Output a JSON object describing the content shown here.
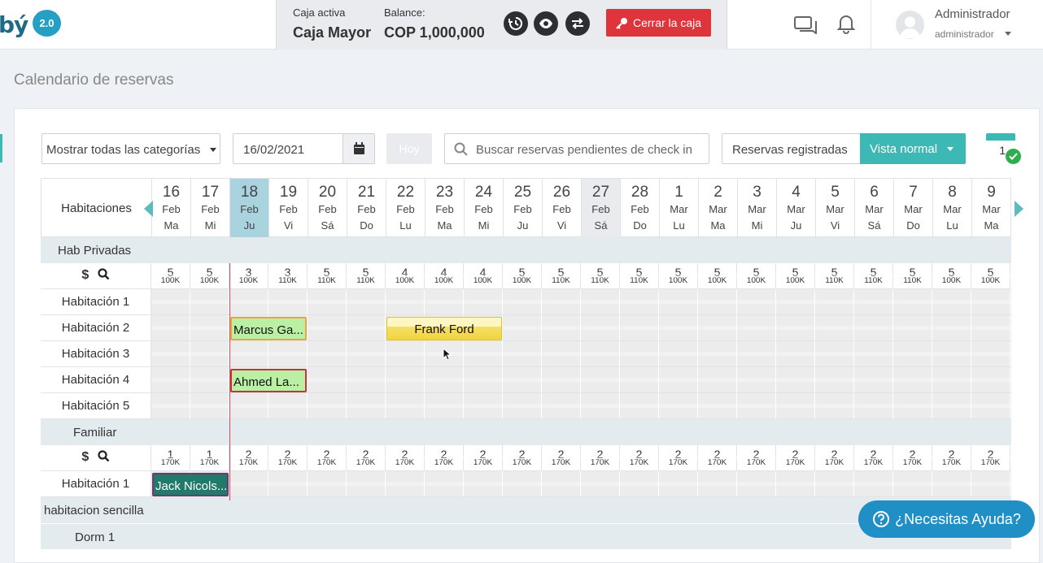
{
  "logo": {
    "letter": "bý",
    "version": "2.0"
  },
  "cashbox": {
    "active_label": "Caja activa",
    "active_value": "Caja Mayor",
    "balance_label": "Balance:",
    "balance_value": "COP 1,000,000",
    "close_label": "Cerrar la caja"
  },
  "user": {
    "name": "Administrador",
    "role": "administrador"
  },
  "page_title": "Calendario de reservas",
  "toolbar": {
    "category_select": "Mostrar todas las categorías",
    "date_value": "16/02/2021",
    "today_label": "Hoy",
    "search_placeholder": "Buscar reservas pendientes de check in",
    "registered_label": "Reservas registradas",
    "view_label": "Vista normal",
    "notif_count": "1"
  },
  "calendar": {
    "rooms_header": "Habitaciones",
    "days": [
      {
        "n": "16",
        "m": "Feb",
        "w": "Ma",
        "s": ""
      },
      {
        "n": "17",
        "m": "Feb",
        "w": "Mi",
        "s": ""
      },
      {
        "n": "18",
        "m": "Feb",
        "w": "Ju",
        "s": "today"
      },
      {
        "n": "19",
        "m": "Feb",
        "w": "Vi",
        "s": ""
      },
      {
        "n": "20",
        "m": "Feb",
        "w": "Sá",
        "s": ""
      },
      {
        "n": "21",
        "m": "Feb",
        "w": "Do",
        "s": ""
      },
      {
        "n": "22",
        "m": "Feb",
        "w": "Lu",
        "s": ""
      },
      {
        "n": "23",
        "m": "Feb",
        "w": "Ma",
        "s": ""
      },
      {
        "n": "24",
        "m": "Feb",
        "w": "Mi",
        "s": ""
      },
      {
        "n": "25",
        "m": "Feb",
        "w": "Ju",
        "s": ""
      },
      {
        "n": "26",
        "m": "Feb",
        "w": "Vi",
        "s": ""
      },
      {
        "n": "27",
        "m": "Feb",
        "w": "Sá",
        "s": "weekend"
      },
      {
        "n": "28",
        "m": "Feb",
        "w": "Do",
        "s": ""
      },
      {
        "n": "1",
        "m": "Mar",
        "w": "Lu",
        "s": ""
      },
      {
        "n": "2",
        "m": "Mar",
        "w": "Ma",
        "s": ""
      },
      {
        "n": "3",
        "m": "Mar",
        "w": "Mi",
        "s": ""
      },
      {
        "n": "4",
        "m": "Mar",
        "w": "Ju",
        "s": ""
      },
      {
        "n": "5",
        "m": "Mar",
        "w": "Vi",
        "s": ""
      },
      {
        "n": "6",
        "m": "Mar",
        "w": "Sá",
        "s": ""
      },
      {
        "n": "7",
        "m": "Mar",
        "w": "Do",
        "s": ""
      },
      {
        "n": "8",
        "m": "Mar",
        "w": "Lu",
        "s": ""
      },
      {
        "n": "9",
        "m": "Mar",
        "w": "Ma",
        "s": ""
      }
    ],
    "categories": [
      {
        "name": "Hab Privadas",
        "availability": [
          "5",
          "5",
          "3",
          "3",
          "5",
          "5",
          "4",
          "4",
          "4",
          "5",
          "5",
          "5",
          "5",
          "5",
          "5",
          "5",
          "5",
          "5",
          "5",
          "5",
          "5",
          "5"
        ],
        "prices": [
          "100K",
          "100K",
          "100K",
          "110K",
          "110K",
          "110K",
          "100K",
          "100K",
          "100K",
          "100K",
          "110K",
          "110K",
          "110K",
          "100K",
          "100K",
          "100K",
          "100K",
          "110K",
          "110K",
          "110K",
          "100K",
          "100K"
        ],
        "rooms": [
          "Habitación 1",
          "Habitación 2",
          "Habitación 3",
          "Habitación 4",
          "Habitación 5"
        ]
      },
      {
        "name": "Familiar",
        "availability": [
          "1",
          "1",
          "2",
          "2",
          "2",
          "2",
          "2",
          "2",
          "2",
          "2",
          "2",
          "2",
          "2",
          "2",
          "2",
          "2",
          "2",
          "2",
          "2",
          "2",
          "2",
          "2"
        ],
        "prices": [
          "170K",
          "170K",
          "170K",
          "170K",
          "170K",
          "170K",
          "170K",
          "170K",
          "170K",
          "170K",
          "170K",
          "170K",
          "170K",
          "170K",
          "170K",
          "170K",
          "170K",
          "170K",
          "170K",
          "170K",
          "170K",
          "170K"
        ],
        "rooms": [
          "Habitación 1"
        ]
      },
      {
        "name": "habitacion sencilla"
      },
      {
        "name": "Dorm 1"
      }
    ],
    "bookings": {
      "marcus": "Marcus Ga...",
      "frank": "Frank Ford",
      "ahmed": "Ahmed La...",
      "jack": "Jack Nicols..."
    }
  },
  "help_label": "¿Necesitas Ayuda?",
  "colors": {
    "accent": "#3cb8b5",
    "danger": "#e0343c",
    "help": "#1f8fc6"
  }
}
